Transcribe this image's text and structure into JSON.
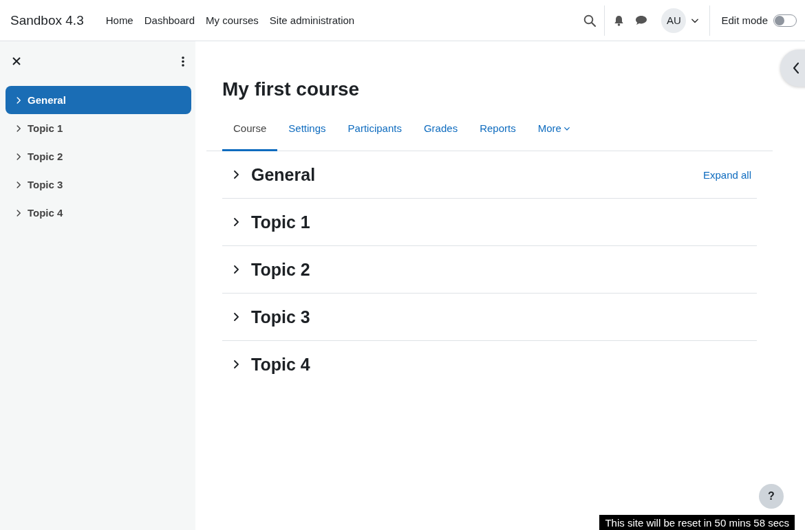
{
  "site_name": "Sandbox 4.3",
  "nav": [
    {
      "label": "Home"
    },
    {
      "label": "Dashboard"
    },
    {
      "label": "My courses"
    },
    {
      "label": "Site administration"
    }
  ],
  "user": {
    "initials": "AU"
  },
  "edit_mode": {
    "label": "Edit mode",
    "on": false
  },
  "course_index": {
    "items": [
      {
        "label": "General",
        "selected": true
      },
      {
        "label": "Topic 1",
        "selected": false
      },
      {
        "label": "Topic 2",
        "selected": false
      },
      {
        "label": "Topic 3",
        "selected": false
      },
      {
        "label": "Topic 4",
        "selected": false
      }
    ]
  },
  "course": {
    "title": "My first course",
    "tabs": [
      {
        "label": "Course",
        "kind": "link",
        "selected": true
      },
      {
        "label": "Settings",
        "kind": "link",
        "selected": false
      },
      {
        "label": "Participants",
        "kind": "link",
        "selected": false
      },
      {
        "label": "Grades",
        "kind": "link",
        "selected": false
      },
      {
        "label": "Reports",
        "kind": "link",
        "selected": false
      },
      {
        "label": "More",
        "kind": "menu",
        "selected": false
      }
    ],
    "expand_all": "Expand all",
    "sections": [
      {
        "title": "General",
        "expanded": false
      },
      {
        "title": "Topic 1",
        "expanded": false
      },
      {
        "title": "Topic 2",
        "expanded": false
      },
      {
        "title": "Topic 3",
        "expanded": false
      },
      {
        "title": "Topic 4",
        "expanded": false
      }
    ]
  },
  "help": "?",
  "reset_notice": "This site will be reset in 50 mins 58 secs"
}
